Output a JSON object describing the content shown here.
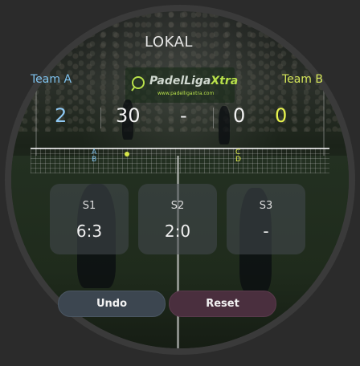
{
  "match": {
    "title": "LOKAL"
  },
  "teams": {
    "a": {
      "name": "Team A",
      "games": "2",
      "points": "30",
      "letters": [
        "A",
        "B"
      ]
    },
    "b": {
      "name": "Team B",
      "games": "0",
      "points": "0",
      "letters": [
        "C",
        "D"
      ]
    }
  },
  "separator": "-",
  "sets": [
    {
      "label": "S1",
      "score": "6:3"
    },
    {
      "label": "S2",
      "score": "2:0"
    },
    {
      "label": "S3",
      "score": "-"
    }
  ],
  "sponsor": {
    "name_prefix": "PadelLiga",
    "name_suffix": "Xtra",
    "url": "www.padelligaxtra.com"
  },
  "buttons": {
    "undo": "Undo",
    "reset": "Reset"
  },
  "colors": {
    "team_a": "#7fc3f0",
    "team_b": "#e6f24d",
    "undo_bg": "#3c4650",
    "reset_bg": "#4a2f3e"
  }
}
